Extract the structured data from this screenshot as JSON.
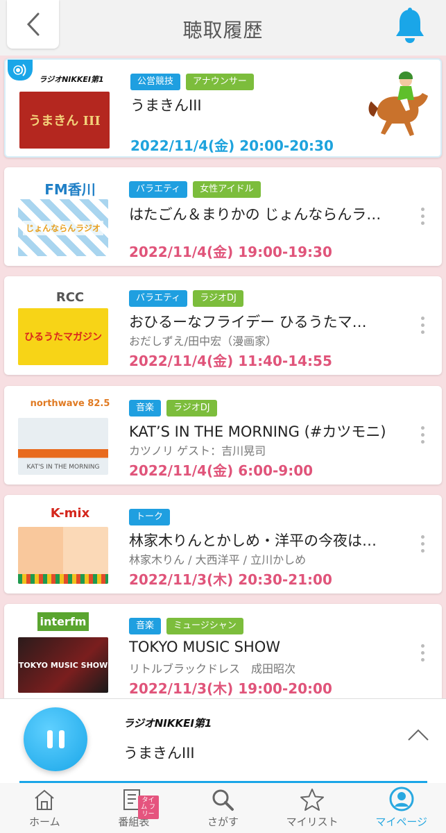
{
  "header": {
    "title": "聴取履歴"
  },
  "history": [
    {
      "station": "ラジオNIKKEI第1",
      "tags": [
        {
          "label": "公営競技",
          "color": "blue"
        },
        {
          "label": "アナウンサー",
          "color": "green"
        }
      ],
      "title": "うまきんIII",
      "cast": "",
      "datetime": "2022/11/4(金) 20:00-20:30",
      "thumb_text": "うまきん III",
      "now_playing": true
    },
    {
      "station": "FM香川",
      "tags": [
        {
          "label": "バラエティ",
          "color": "blue"
        },
        {
          "label": "女性アイドル",
          "color": "green"
        }
      ],
      "title": "はたごん＆まりかの じょんならんラ…",
      "cast": "",
      "datetime": "2022/11/4(金) 19:00-19:30",
      "thumb_text": "じょんならんラジオ"
    },
    {
      "station": "RCC",
      "tags": [
        {
          "label": "バラエティ",
          "color": "blue"
        },
        {
          "label": "ラジオDJ",
          "color": "green"
        }
      ],
      "title": "おひるーなフライデー ひるうたマ…",
      "cast": "おだしずえ/田中宏（漫画家）",
      "datetime": "2022/11/4(金) 11:40-14:55",
      "thumb_text": "ひるうたマガジン"
    },
    {
      "station": "northwave 82.5",
      "tags": [
        {
          "label": "音楽",
          "color": "blue"
        },
        {
          "label": "ラジオDJ",
          "color": "green"
        }
      ],
      "title": "KAT’S IN THE MORNING (#カツモニ)",
      "cast": "カツノリ ゲスト：吉川晃司",
      "datetime": "2022/11/4(金) 6:00-9:00",
      "thumb_text": "KAT'S IN THE MORNING"
    },
    {
      "station": "K-mix",
      "tags": [
        {
          "label": "トーク",
          "color": "blue"
        }
      ],
      "title": "林家木りんとかしめ・洋平の今夜は…",
      "cast": "林家木りん / 大西洋平 / 立川かしめ",
      "datetime": "2022/11/3(木) 20:30-21:00",
      "thumb_text": ""
    },
    {
      "station": "interfm",
      "tags": [
        {
          "label": "音楽",
          "color": "blue"
        },
        {
          "label": "ミュージシャン",
          "color": "green"
        }
      ],
      "title": "TOKYO MUSIC SHOW",
      "cast": "リトルブラックドレス　成田昭次",
      "datetime": "2022/11/3(木) 19:00-20:00",
      "thumb_text": "TOKYO MUSIC SHOW"
    }
  ],
  "player": {
    "station": "ラジオNIKKEI第1",
    "title": "うまきんIII"
  },
  "tabs": [
    {
      "label": "ホーム",
      "icon": "home-icon"
    },
    {
      "label": "番組表",
      "icon": "program-guide-icon",
      "badge": "タイム フリー"
    },
    {
      "label": "さがす",
      "icon": "search-icon"
    },
    {
      "label": "マイリスト",
      "icon": "star-icon"
    },
    {
      "label": "マイページ",
      "icon": "person-icon",
      "active": true
    }
  ],
  "colors": {
    "accent": "#1aa6e8",
    "date_pink": "#e0547a",
    "tag_blue": "#1f9fe0",
    "tag_green": "#7cbd3c"
  }
}
